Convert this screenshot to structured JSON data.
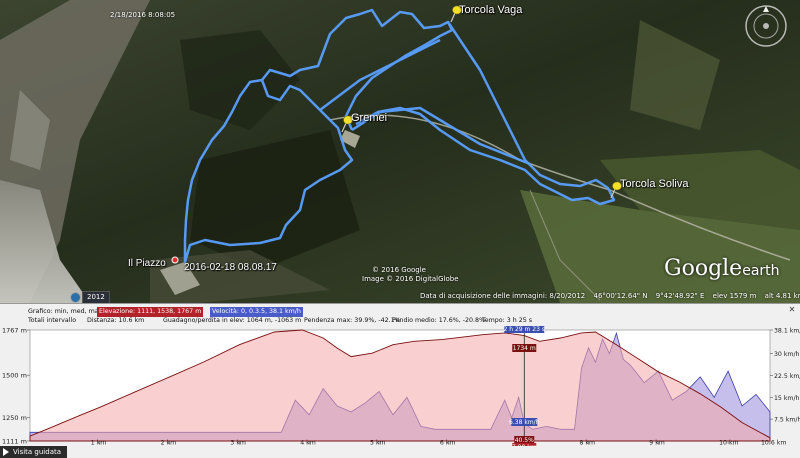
{
  "map": {
    "timestamp_top": "2/18/2016 8:08:05",
    "places": {
      "torcola_vaga": "Torcola Vaga",
      "gremei": "Gremei",
      "torcola_soliva": "Torcola Soliva",
      "il_piazzo": "Il Piazzo",
      "track_time": "2016-02-18 08.08.17"
    },
    "copyright1": "© 2016 Google",
    "copyright2": "Image © 2016 DigitalGlobe",
    "year_badge": "2012",
    "status": {
      "acq_date": "Data di acquisizione delle immagini: 8/20/2012",
      "lat": "46°00'12.64\" N",
      "lon": "9°42'48.92\" E",
      "elev": "elev  1579 m",
      "alt": "alt  4.81 km"
    },
    "logo_main": "Google",
    "logo_sub": "earth",
    "track_color": "#5aa0ff"
  },
  "profile": {
    "row1": {
      "label": "Grafico: min, med, max",
      "elevation": "Elevazione: 1111, 1538, 1767 m",
      "speed": "Velocità: 0, 0.3.5, 38.1 km/h"
    },
    "row2": {
      "label": "Totali intervallo",
      "distance": "Distanza: 10.6 km",
      "gain_loss": "Guadagno/perdita in elev: 1064 m, -1063 m",
      "slope": "Pendenza max: 39.9%, -42.1%",
      "avg_slope": "Pendio medio: 17.6%, -20.8%",
      "time": "Tempo: 3 h 25 s"
    },
    "cursor": {
      "time": "2 h 29 m 23 s",
      "elev": "1734 m",
      "speed": "6.38 km/h",
      "grade": "40.5%",
      "dist": "7.08 km"
    },
    "y_left": [
      "1767 m",
      "1500 m",
      "1250 m",
      "1111 m"
    ],
    "y_right": [
      "38.1 km/h",
      "30 km/h",
      "22.5 km/h",
      "15 km/h",
      "7.5 km/h"
    ],
    "x_labels": [
      "1 km",
      "2 km",
      "3 km",
      "4 km",
      "5 km",
      "6 km",
      "8 km",
      "9 km",
      "10 km",
      "10.6 km"
    ],
    "tour_button": "Visita guidata"
  },
  "chart_data": {
    "type": "area",
    "xlim": [
      0,
      10.6
    ],
    "series": [
      {
        "name": "Elevazione",
        "unit": "m",
        "ylim": [
          1111,
          1767
        ],
        "x": [
          0,
          0.3,
          0.7,
          1.0,
          1.5,
          2.0,
          2.5,
          3.0,
          3.5,
          3.9,
          4.2,
          4.4,
          4.6,
          4.9,
          5.2,
          5.5,
          5.9,
          6.2,
          6.5,
          6.8,
          7.08,
          7.3,
          7.6,
          7.9,
          8.1,
          8.4,
          8.7,
          9.0,
          9.3,
          9.6,
          9.9,
          10.2,
          10.6
        ],
        "y": [
          1140,
          1190,
          1260,
          1310,
          1400,
          1490,
          1580,
          1680,
          1755,
          1767,
          1720,
          1660,
          1610,
          1630,
          1680,
          1700,
          1710,
          1725,
          1740,
          1750,
          1734,
          1700,
          1720,
          1750,
          1755,
          1680,
          1600,
          1520,
          1460,
          1390,
          1310,
          1220,
          1130
        ]
      },
      {
        "name": "Velocità",
        "unit": "km/h",
        "ylim": [
          0,
          38.1
        ],
        "x": [
          0,
          0.4,
          0.8,
          1.2,
          1.6,
          2.0,
          2.4,
          2.8,
          3.2,
          3.6,
          3.8,
          4.0,
          4.2,
          4.4,
          4.6,
          4.8,
          5.0,
          5.2,
          5.4,
          5.6,
          5.8,
          6.0,
          6.2,
          6.4,
          6.6,
          6.8,
          6.9,
          7.0,
          7.08,
          7.2,
          7.4,
          7.6,
          7.8,
          7.9,
          8.0,
          8.1,
          8.2,
          8.3,
          8.4,
          8.5,
          8.6,
          8.8,
          9.0,
          9.2,
          9.4,
          9.6,
          9.8,
          10.0,
          10.2,
          10.4,
          10.6
        ],
        "y": [
          3,
          3,
          3,
          3,
          3,
          3,
          3,
          3,
          3,
          3,
          14,
          9,
          18,
          12,
          10,
          13,
          17,
          9,
          15,
          5,
          4,
          4,
          4,
          4,
          4,
          14,
          8,
          15,
          6,
          4,
          5,
          4,
          4,
          25,
          32,
          27,
          35,
          30,
          37,
          28,
          26,
          20,
          24,
          14,
          17,
          22,
          15,
          24,
          12,
          16,
          10
        ]
      }
    ],
    "cursor_x": 7.08
  }
}
